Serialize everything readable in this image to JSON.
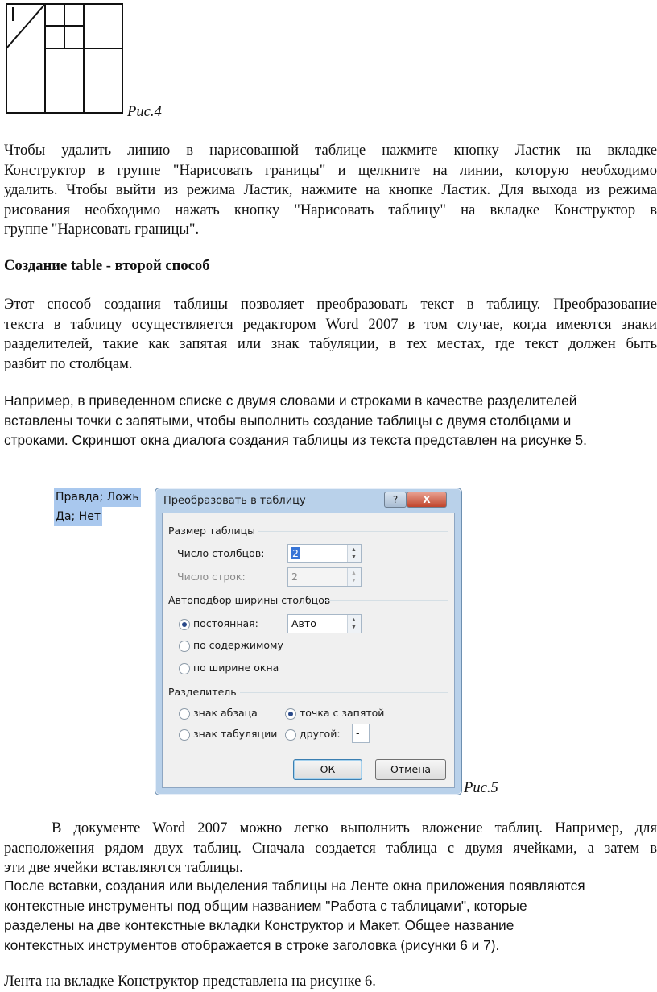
{
  "figure4": {
    "caption": "Рис.4"
  },
  "para1": [
    "Чтобы удалить линию в нарисованной таблице нажмите кнопку Ластик на вкладке",
    "Конструктор в группе \"Нарисовать границы\" и щелкните на линии, которую необходимо",
    "удалить. Чтобы выйти из режима Ластик, нажмите на кнопке Ластик. Для выхода из режима",
    "рисования необходимо нажать кнопку \"Нарисовать таблицу\" на вкладке Конструктор в",
    "группе \"Нарисовать границы\"."
  ],
  "heading": "Создание table - второй способ",
  "para2": [
    "Этот способ создания таблицы позволяет преобразовать текст в таблицу. Преобразование",
    "текста в таблицу осуществляется редактором Word 2007 в том случае, когда имеются знаки",
    "разделителей, такие как запятая или знак табуляции, в тех местах, где текст должен быть",
    "разбит по столбцам."
  ],
  "para3": [
    "Например, в приведенном списке с двумя словами и строками в качестве разделителей",
    "вставлены точки с запятыми, чтобы выполнить создание таблицы с двумя столбцами и",
    "строками. Скриншот окна диалога создания таблицы из текста представлен на рисунке 5."
  ],
  "selected_text": [
    "Правда; Ложь",
    "Да; Нет"
  ],
  "dialog": {
    "title": "Преобразовать в таблицу",
    "help": "?",
    "close": "X",
    "size_group": "Размер таблицы",
    "cols_label": "Число столбцов:",
    "cols_value": "2",
    "rows_label": "Число строк:",
    "rows_value": "2",
    "autofit_group": "Автоподбор ширины столбцов",
    "fixed_label": "постоянная:",
    "fixed_value": "Авто",
    "content_label": "по содержимому",
    "window_label": "по ширине окна",
    "separator_group": "Разделитель",
    "paragraph_label": "знак абзаца",
    "semicolon_label": "точка с запятой",
    "tab_label": "знак табуляции",
    "other_label": "другой:",
    "other_value": "-",
    "ok": "ОК",
    "cancel": "Отмена"
  },
  "figure5": {
    "caption": "Рис.5"
  },
  "para4": [
    "В документе Word 2007 можно легко выполнить вложение таблиц. Например, для",
    "расположения рядом двух таблиц. Сначала создается таблица с двумя ячейками, а затем в",
    "эти две ячейки вставляются таблицы."
  ],
  "para5": [
    "После вставки, создания или выделения таблицы на Ленте окна приложения появляются",
    "контекстные инструменты под общим названием \"Работа с таблицами\", которые",
    "разделены на две контекстные вкладки Конструктор и Макет. Общее название",
    "контекстных инструментов отображается в строке заголовка (рисунки 6 и 7)."
  ],
  "para6": "Лента на вкладке Конструктор представлена на рисунке 6."
}
